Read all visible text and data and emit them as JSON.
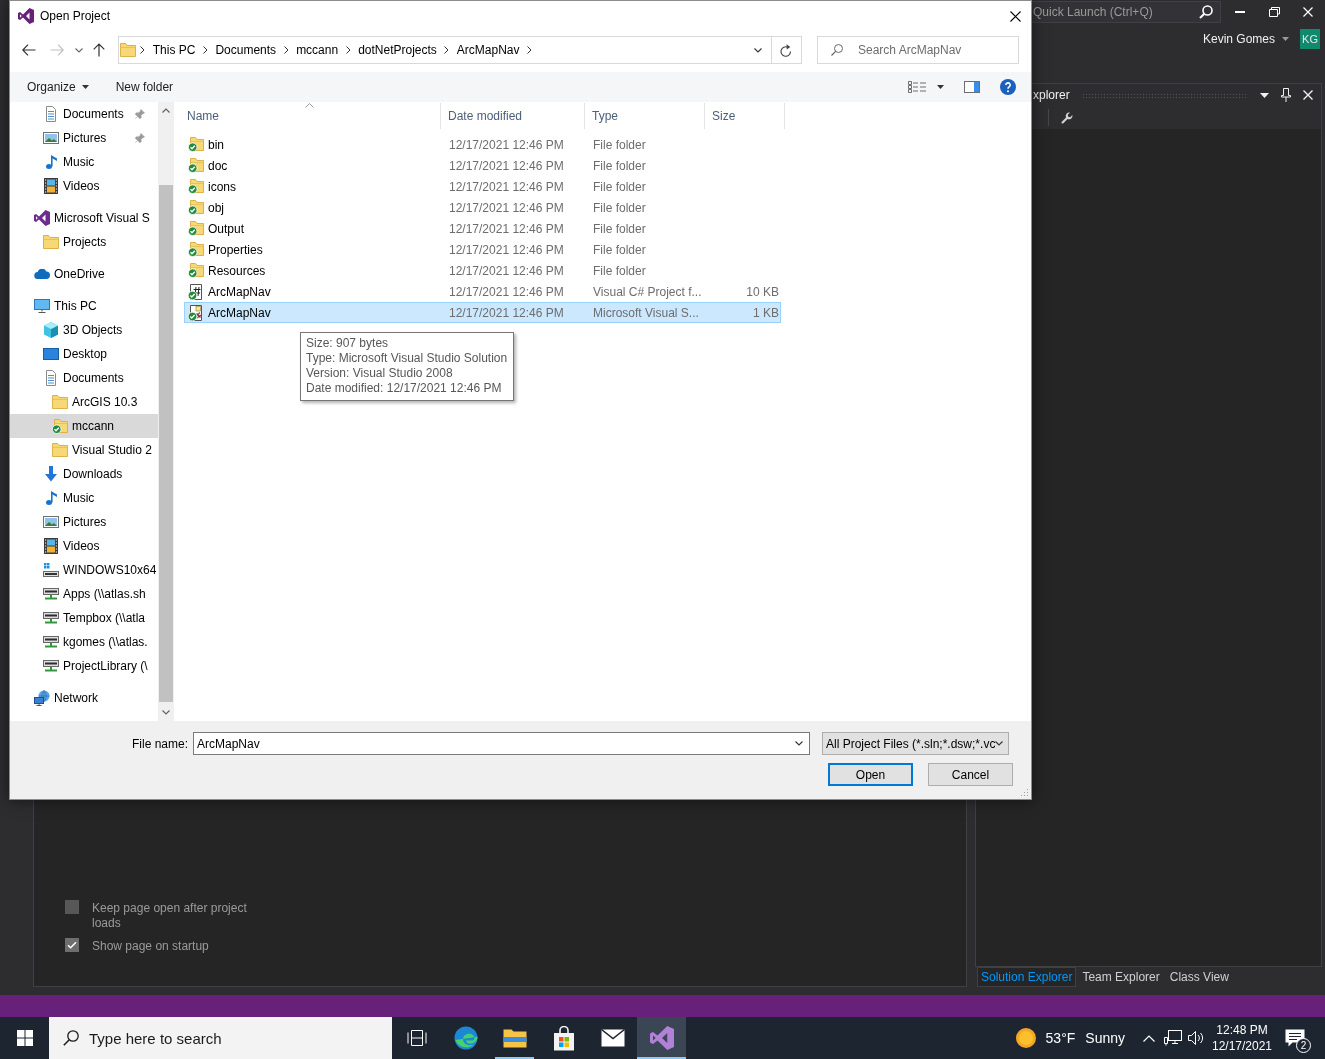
{
  "vs_window": {
    "quick_launch": {
      "placeholder": "Quick Launch (Ctrl+Q)"
    },
    "user": {
      "name": "Kevin Gomes",
      "initials": "KG"
    },
    "tool_window": {
      "title": "xplorer",
      "tabs": [
        {
          "label": "Solution Explorer",
          "selected": true
        },
        {
          "label": "Team Explorer",
          "selected": false
        },
        {
          "label": "Class View",
          "selected": false
        }
      ]
    },
    "start_page": {
      "options": [
        {
          "label": "Keep page open after project loads",
          "checked": false
        },
        {
          "label": "Show page on startup",
          "checked": true
        }
      ]
    }
  },
  "dialog": {
    "title": "Open Project",
    "navigation": {
      "back": {
        "disabled": false
      },
      "forward": {
        "disabled": true
      }
    },
    "address": {
      "crumbs": [
        "This PC",
        "Documents",
        "mccann",
        "dotNetProjects",
        "ArcMapNav"
      ]
    },
    "search": {
      "placeholder": "Search ArcMapNav"
    },
    "toolbar": {
      "organize": "Organize",
      "new_folder": "New folder"
    },
    "sidebar": {
      "tree": [
        {
          "children": [
            {
              "label": "Documents",
              "kind": "documents",
              "pinned": true,
              "selected": false
            },
            {
              "label": "Pictures",
              "kind": "pictures",
              "pinned": true,
              "selected": false
            },
            {
              "label": "Music",
              "kind": "music",
              "pinned": false,
              "selected": false
            },
            {
              "label": "Videos",
              "kind": "videos",
              "pinned": false,
              "selected": false
            }
          ]
        },
        {
          "label": "Microsoft Visual S",
          "kind": "visual-studio",
          "selected": false,
          "children": [
            {
              "label": "Projects",
              "kind": "folder",
              "selected": false
            }
          ]
        },
        {
          "label": "OneDrive",
          "kind": "cloud",
          "selected": false
        },
        {
          "label": "This PC",
          "kind": "computer",
          "selected": false,
          "children": [
            {
              "label": "3D Objects",
              "kind": "cube",
              "selected": false
            },
            {
              "label": "Desktop",
              "kind": "desktop",
              "selected": false
            },
            {
              "label": "Documents",
              "kind": "documents",
              "selected": false,
              "children": [
                {
                  "label": "ArcGIS 10.3",
                  "kind": "folder",
                  "selected": false
                },
                {
                  "label": "mccann",
                  "kind": "synced-folder",
                  "selected": true
                },
                {
                  "label": "Visual Studio 2",
                  "kind": "folder",
                  "selected": false
                }
              ]
            },
            {
              "label": "Downloads",
              "kind": "downloads",
              "selected": false
            },
            {
              "label": "Music",
              "kind": "music",
              "selected": false
            },
            {
              "label": "Pictures",
              "kind": "pictures",
              "selected": false
            },
            {
              "label": "Videos",
              "kind": "videos",
              "selected": false
            },
            {
              "label": "WINDOWS10x64",
              "kind": "system-drive",
              "selected": false
            },
            {
              "label": "Apps (\\\\atlas.sh",
              "kind": "network-drive",
              "selected": false
            },
            {
              "label": "Tempbox (\\\\atla",
              "kind": "network-drive",
              "selected": false
            },
            {
              "label": "kgomes (\\\\atlas.",
              "kind": "network-drive",
              "selected": false
            },
            {
              "label": "ProjectLibrary (\\",
              "kind": "network-drive",
              "selected": false
            }
          ]
        },
        {
          "label": "Network",
          "kind": "network",
          "selected": false
        }
      ]
    },
    "files": {
      "columns": [
        {
          "label": "Name",
          "sorted": true
        },
        {
          "label": "Date modified",
          "sorted": false
        },
        {
          "label": "Type",
          "sorted": false
        },
        {
          "label": "Size",
          "sorted": false
        }
      ],
      "rows": [
        {
          "name": "bin",
          "kind": "synced-folder",
          "date": "12/17/2021 12:46 PM",
          "type": "File folder",
          "selected": false
        },
        {
          "name": "doc",
          "kind": "synced-folder",
          "date": "12/17/2021 12:46 PM",
          "type": "File folder",
          "selected": false
        },
        {
          "name": "icons",
          "kind": "synced-folder",
          "date": "12/17/2021 12:46 PM",
          "type": "File folder",
          "selected": false
        },
        {
          "name": "obj",
          "kind": "synced-folder",
          "date": "12/17/2021 12:46 PM",
          "type": "File folder",
          "selected": false
        },
        {
          "name": "Output",
          "kind": "synced-folder",
          "date": "12/17/2021 12:46 PM",
          "type": "File folder",
          "selected": false
        },
        {
          "name": "Properties",
          "kind": "synced-folder",
          "date": "12/17/2021 12:46 PM",
          "type": "File folder",
          "selected": false
        },
        {
          "name": "Resources",
          "kind": "synced-folder",
          "date": "12/17/2021 12:46 PM",
          "type": "File folder",
          "selected": false
        },
        {
          "name": "ArcMapNav",
          "kind": "csharp-project",
          "date": "12/17/2021 12:46 PM",
          "type": "Visual C# Project f...",
          "size": "10 KB",
          "selected": false
        },
        {
          "name": "ArcMapNav",
          "kind": "solution",
          "date": "12/17/2021 12:46 PM",
          "type": "Microsoft Visual S...",
          "size": "1 KB",
          "selected": true
        }
      ]
    },
    "tooltip": {
      "lines": [
        "Size: 907 bytes",
        "Type: Microsoft Visual Studio Solution",
        "Version: Visual Studio 2008",
        "Date modified: 12/17/2021 12:46 PM"
      ]
    },
    "file_name": {
      "label": "File name:",
      "value": "ArcMapNav"
    },
    "file_type": {
      "value": "All Project Files (*.sln;*.dsw;*.vc"
    },
    "buttons": [
      {
        "label": "Open",
        "default": true
      },
      {
        "label": "Cancel",
        "default": false
      }
    ]
  },
  "taskbar": {
    "search": {
      "placeholder": "Type here to search"
    },
    "apps": [
      {
        "kind": "task-view",
        "running": false,
        "selected": false
      },
      {
        "kind": "browser",
        "running": false,
        "selected": false
      },
      {
        "kind": "files",
        "running": true,
        "selected": false
      },
      {
        "kind": "store",
        "running": false,
        "selected": false
      },
      {
        "kind": "mail",
        "running": false,
        "selected": false
      },
      {
        "kind": "ide",
        "running": true,
        "selected": true
      }
    ],
    "weather": {
      "temperature": "53°F",
      "condition": "Sunny"
    },
    "clock": {
      "time": "12:48 PM",
      "date": "12/17/2021"
    },
    "notifications": {
      "count": "2"
    }
  }
}
